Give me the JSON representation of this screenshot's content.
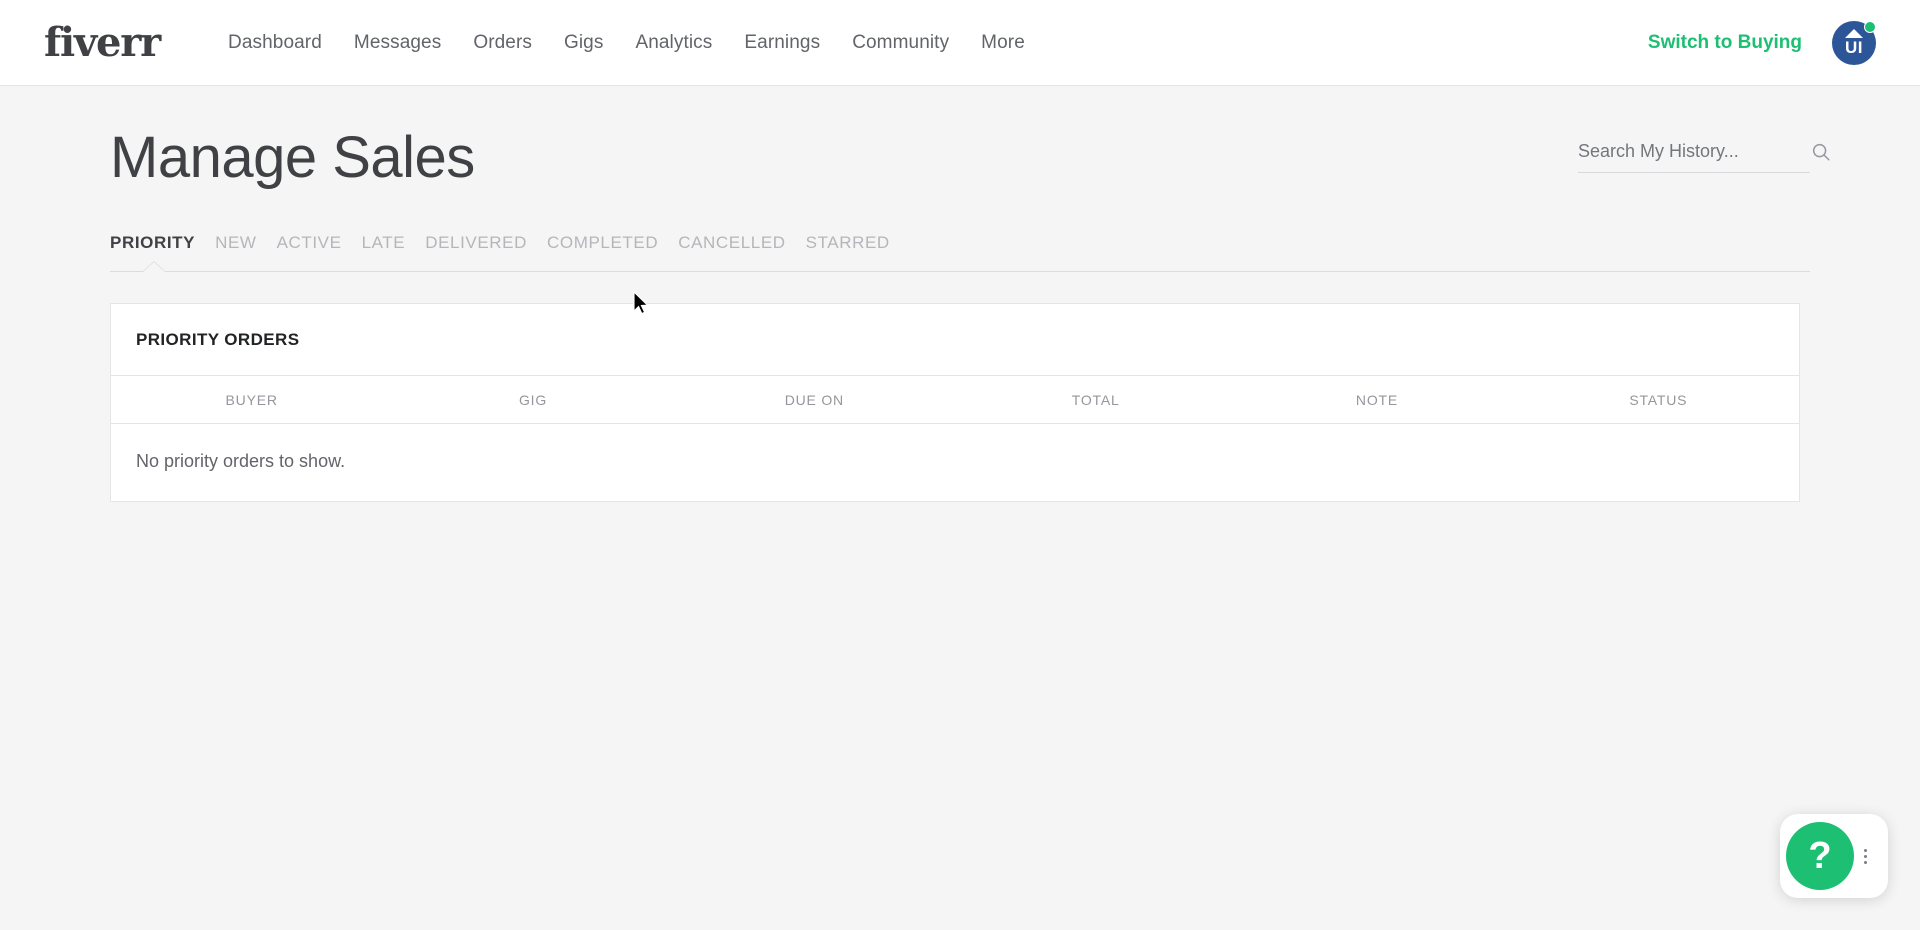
{
  "header": {
    "logo_text": "fiverr",
    "nav_items": [
      {
        "label": "Dashboard"
      },
      {
        "label": "Messages"
      },
      {
        "label": "Orders"
      },
      {
        "label": "Gigs"
      },
      {
        "label": "Analytics"
      },
      {
        "label": "Earnings"
      },
      {
        "label": "Community"
      },
      {
        "label": "More"
      }
    ],
    "switch_label": "Switch to Buying",
    "avatar_initials": "UI",
    "avatar_bg": "#2d5699",
    "status_color": "#1dbf73"
  },
  "page": {
    "title": "Manage Sales"
  },
  "search": {
    "value": "",
    "placeholder": "Search My History...",
    "icon": "search-icon"
  },
  "tabs": {
    "active_index": 0,
    "items": [
      {
        "label": "PRIORITY"
      },
      {
        "label": "NEW"
      },
      {
        "label": "ACTIVE"
      },
      {
        "label": "LATE"
      },
      {
        "label": "DELIVERED"
      },
      {
        "label": "COMPLETED"
      },
      {
        "label": "CANCELLED"
      },
      {
        "label": "STARRED"
      }
    ]
  },
  "orders_card": {
    "title": "PRIORITY ORDERS",
    "columns": [
      {
        "label": "BUYER"
      },
      {
        "label": "GIG"
      },
      {
        "label": "DUE ON"
      },
      {
        "label": "TOTAL"
      },
      {
        "label": "NOTE"
      },
      {
        "label": "STATUS"
      }
    ],
    "rows": [],
    "empty_message": "No priority orders to show."
  },
  "help_widget": {
    "button_label": "?",
    "button_color": "#1dbf73",
    "menu_icon": "kebab-menu-icon"
  },
  "colors": {
    "accent_green": "#1dbf73",
    "page_bg": "#f5f5f5",
    "card_bg": "#ffffff",
    "border": "#e4e5e7",
    "text_primary": "#404145",
    "text_muted": "#95979d"
  }
}
